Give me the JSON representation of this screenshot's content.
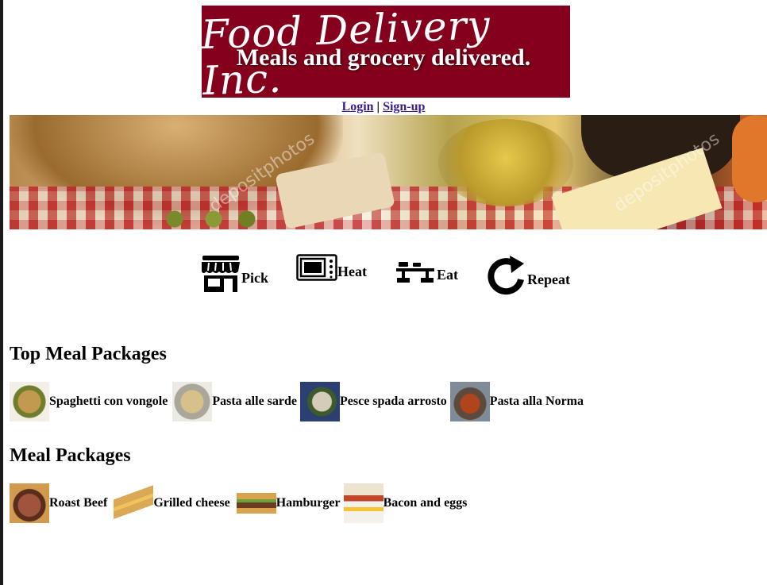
{
  "header": {
    "logo_text": "Food Delivery Inc.",
    "logo_bg": "#85001c",
    "login_label": "Login",
    "separator": "|",
    "signup_label": "Sign-up"
  },
  "hero": {
    "headline": "Meals and grocery delivered.",
    "watermark": "depositphotos"
  },
  "steps": [
    {
      "icon": "store-icon",
      "label": "Pick"
    },
    {
      "icon": "microwave-icon",
      "label": "Heat"
    },
    {
      "icon": "dining-table-icon",
      "label": "Eat"
    },
    {
      "icon": "redo-icon",
      "label": "Repeat"
    }
  ],
  "top_meal_packages": {
    "heading": "Top Meal Packages",
    "items": [
      {
        "name": "Spaghetti con vongole"
      },
      {
        "name": "Pasta alle sarde"
      },
      {
        "name": "Pesce spada arrosto"
      },
      {
        "name": "Pasta alla Norma"
      }
    ]
  },
  "meal_packages": {
    "heading": "Meal Packages",
    "items": [
      {
        "name": "Roast Beef"
      },
      {
        "name": "Grilled cheese"
      },
      {
        "name": "Hamburger"
      },
      {
        "name": "Bacon and eggs"
      }
    ]
  }
}
